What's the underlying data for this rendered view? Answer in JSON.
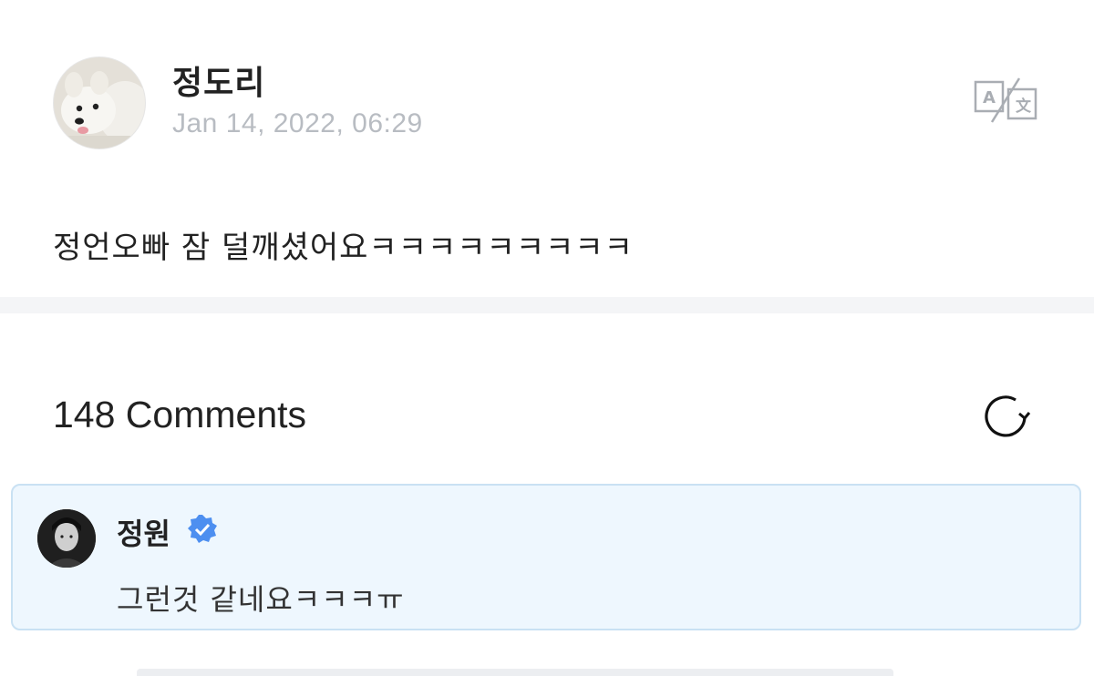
{
  "post": {
    "author": "정도리",
    "date": "Jan 14, 2022, 06:29",
    "body": "정언오빠 잠 덜깨셨어요ㅋㅋㅋㅋㅋㅋㅋㅋㅋ",
    "translate_icon": "translate-icon"
  },
  "comments": {
    "count_label": "148 Comments",
    "refresh_icon": "refresh-icon",
    "items": [
      {
        "author": "정원",
        "verified": true,
        "text": "그런것 같네요ㅋㅋㅋㅠ"
      }
    ]
  },
  "colors": {
    "highlight_bg": "#eef7fe",
    "highlight_border": "#c9e1f3",
    "verified_blue": "#4d8ff0",
    "muted_text": "#b8bcc2"
  }
}
